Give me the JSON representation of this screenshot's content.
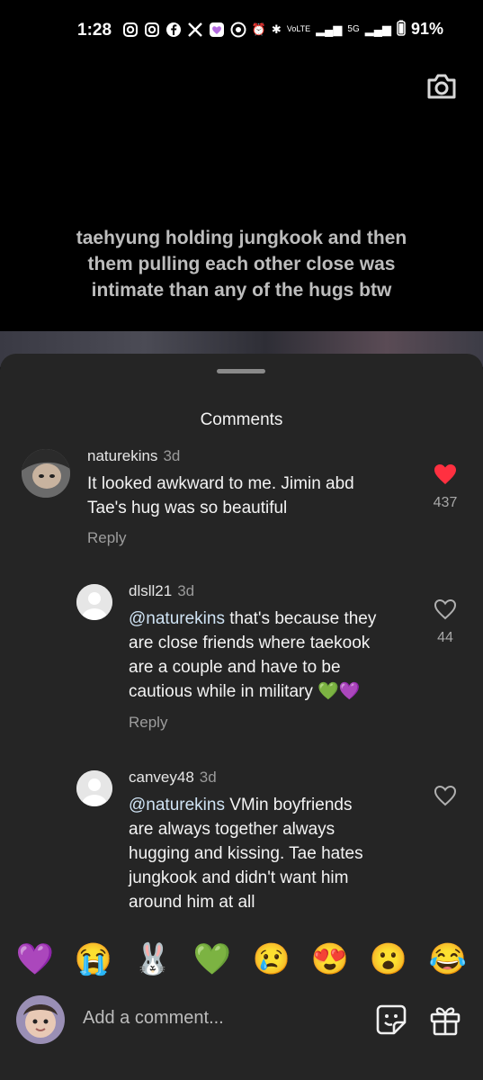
{
  "status_bar": {
    "time": "1:28",
    "battery": "91%",
    "network": "5G",
    "app_icons": [
      "instagram-icon",
      "instagram-icon",
      "facebook-icon",
      "x-icon",
      "heart-app-icon",
      "whatsapp-icon"
    ]
  },
  "video": {
    "caption_lines": [
      "taehyung holding jungkook and then",
      "them pulling each other close was",
      "intimate than any of the hugs btw"
    ]
  },
  "sheet": {
    "title": "Comments"
  },
  "comments": [
    {
      "username": "naturekins",
      "time": "3d",
      "lines": [
        "It looked awkward to me. Jimin abd",
        "Tae's hug was so beautiful"
      ],
      "reply_label": "Reply",
      "like_count": "437",
      "liked": true
    },
    {
      "username": "dlsll21",
      "time": "3d",
      "mention": "@naturekins",
      "lines": [
        " that's because they",
        "are close friends where taekook",
        "are a couple and have to be",
        "cautious while in military 💚💜"
      ],
      "reply_label": "Reply",
      "like_count": "44",
      "liked": false
    },
    {
      "username": "canvey48",
      "time": "3d",
      "mention": "@naturekins",
      "lines": [
        " VMin boyfriends",
        "are always together always",
        "hugging and kissing. Tae hates",
        "jungkook and didn't want him",
        "around him at all"
      ],
      "liked": false
    }
  ],
  "emoji_bar": [
    "💜",
    "😭",
    "🐰",
    "💚",
    "😢",
    "😍",
    "😮",
    "😂"
  ],
  "composer": {
    "placeholder": "Add a comment..."
  },
  "colors": {
    "sheet_bg": "#252525",
    "heart_red": "#ff3040",
    "mention": "#cfe3f4"
  }
}
